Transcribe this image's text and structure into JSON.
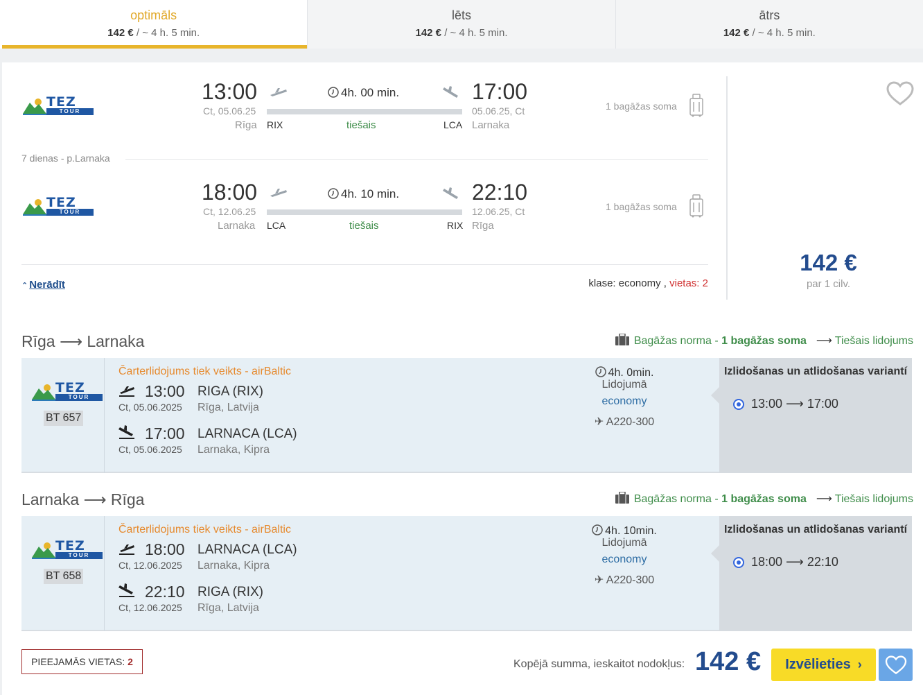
{
  "tabs": [
    {
      "title": "optimāls",
      "price": "142 €",
      "sub": " / ~ 4 h. 5 min."
    },
    {
      "title": "lēts",
      "price": "142 €",
      "sub": " / ~ 4 h. 5 min."
    },
    {
      "title": "ātrs",
      "price": "142 €",
      "sub": " / ~ 4 h. 5 min."
    }
  ],
  "summary": {
    "outbound": {
      "dep_time": "13:00",
      "dep_date": "Ct, 05.06.25",
      "dep_city": "Rīga",
      "dep_code": "RIX",
      "duration": "4h. 00 min.",
      "direct": "tiešais",
      "arr_time": "17:00",
      "arr_date": "05.06.25, Ct",
      "arr_city": "Larnaka",
      "arr_code": "LCA",
      "baggage": "1 bagāžas soma"
    },
    "stay": "7 dienas - p.Larnaka",
    "inbound": {
      "dep_time": "18:00",
      "dep_date": "Ct, 12.06.25",
      "dep_city": "Larnaka",
      "dep_code": "LCA",
      "duration": "4h. 10 min.",
      "direct": "tiešais",
      "arr_time": "22:10",
      "arr_date": "12.06.25, Ct",
      "arr_city": "Rīga",
      "arr_code": "RIX",
      "baggage": "1 bagāžas soma"
    },
    "hide_link": "Nerādīt",
    "class_label": "klase: economy ,",
    "seats_label": "vietas: 2",
    "price": "142 €",
    "price_per": "par 1 cilv."
  },
  "airline": {
    "logo_top": "TEZ",
    "logo_bottom": "TOUR"
  },
  "details": [
    {
      "route": "Rīga ⟶ Larnaka",
      "baggage_norm": "Bagāžas norma",
      "baggage_value": "1 bagāžas soma",
      "flight_type": "Tiešais lidojums",
      "flight_no": "BT 657",
      "charter": "Čarterlidojums tiek veikts - airBaltic",
      "dep_time": "13:00",
      "dep_airport": "RIGA (RIX)",
      "dep_date": "Ct, 05.06.2025",
      "dep_city": "Rīga, Latvija",
      "arr_time": "17:00",
      "arr_airport": "LARNACA (LCA)",
      "arr_date": "Ct, 05.06.2025",
      "arr_city": "Larnaka, Kipra",
      "duration": "4h. 0min.",
      "inflight": "Lidojumā",
      "class": "economy",
      "aircraft": "A220-300",
      "variants_title": "Izlidošanas un atlidošanas variantí",
      "variant": "13:00 ⟶ 17:00"
    },
    {
      "route": "Larnaka ⟶ Rīga",
      "baggage_norm": "Bagāžas norma",
      "baggage_value": "1 bagāžas soma",
      "flight_type": "Tiešais lidojums",
      "flight_no": "BT 658",
      "charter": "Čarterlidojums tiek veikts - airBaltic",
      "dep_time": "18:00",
      "dep_airport": "LARNACA (LCA)",
      "dep_date": "Ct, 12.06.2025",
      "dep_city": "Larnaka, Kipra",
      "arr_time": "22:10",
      "arr_airport": "RIGA (RIX)",
      "arr_date": "Ct, 12.06.2025",
      "arr_city": "Rīga, Latvija",
      "duration": "4h. 10min.",
      "inflight": "Lidojumā",
      "class": "economy",
      "aircraft": "A220-300",
      "variants_title": "Izlidošanas un atlidošanas variantí",
      "variant": "18:00 ⟶ 22:10"
    }
  ],
  "footer": {
    "seats_label": "PIEEJAMĀS VIETAS:",
    "seats_value": "2",
    "total_label": "Kopējā summa, ieskaitot nodokļus:",
    "total_price": "142 €",
    "choose_button": "Izvēlieties"
  },
  "colors": {
    "accent_yellow": "#e8b52b",
    "brand_blue": "#234c8e",
    "direct_green": "#3f8d4a",
    "charter_orange": "#e68a2e",
    "seats_red": "#a12c2c"
  }
}
